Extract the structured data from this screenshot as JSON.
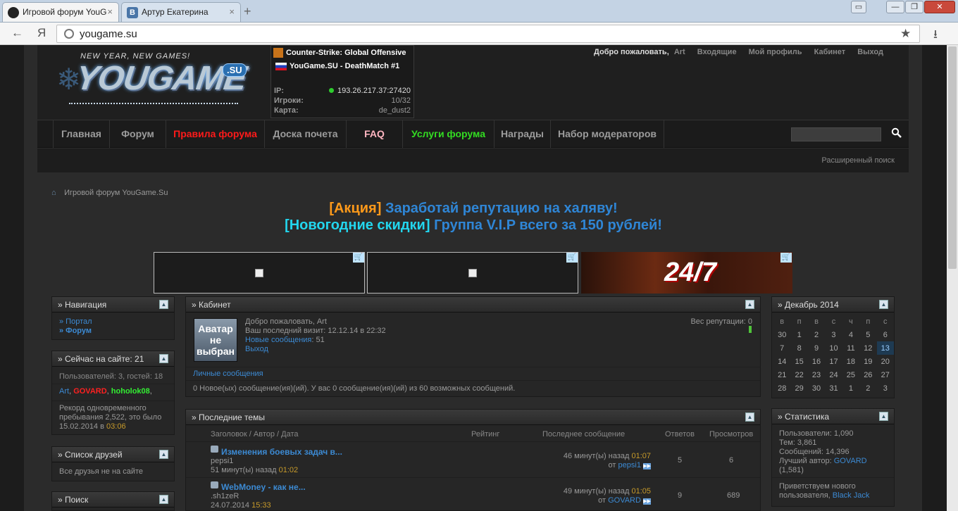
{
  "browser": {
    "tabs": [
      {
        "label": "Игровой форум YouG",
        "close": "×"
      },
      {
        "label": "Артур Екатерина",
        "close": "×"
      }
    ],
    "new_tab": "+",
    "window_controls": [
      "▭",
      "—",
      "❐",
      "✕"
    ],
    "url": "yougame.su",
    "yandex_label": "Я",
    "back": "←",
    "star": "★",
    "download": "⭳"
  },
  "logo": {
    "tagline": "NEW YEAR, NEW GAMES!",
    "text": "YOUGAME",
    "badge": ".SU"
  },
  "server": {
    "game": "Counter-Strike: Global Offensive",
    "name": "YouGame.SU - DeathMatch #1",
    "ip_label": "IP:",
    "ip": "193.26.217.37:27420",
    "players_label": "Игроки:",
    "players": "10/32",
    "map_label": "Карта:",
    "map": "de_dust2"
  },
  "user_links": {
    "welcome": "Добро пожаловать,",
    "user": "Art",
    "inbox": "Входящие",
    "profile": "Мой профиль",
    "cabinet": "Кабинет",
    "logout": "Выход"
  },
  "nav": [
    {
      "label": "Главная",
      "color": "#9c9c9c"
    },
    {
      "label": "Форум",
      "color": "#9c9c9c"
    },
    {
      "label": "Правила форума",
      "color": "#ff1a1a"
    },
    {
      "label": "Доска почета",
      "color": "#9c9c9c"
    },
    {
      "label": "FAQ",
      "color": "#ffb6c1"
    },
    {
      "label": "Услуги форума",
      "color": "#33dd22"
    },
    {
      "label": "Награды",
      "color": "#9c9c9c"
    },
    {
      "label": "Набор модераторов",
      "color": "#9c9c9c"
    }
  ],
  "advanced_search": "Расширенный поиск",
  "breadcrumb": "Игровой форум YouGame.Su",
  "promo": {
    "line1_tag": "[Акция]",
    "line1_text": "Заработай репутацию на халяву!",
    "line2_tag": "[Новогодние скидки]",
    "line2_text": "Группа V.I.P всего за 150 рублей!"
  },
  "banner_text": "24/7",
  "left": {
    "navigation": {
      "title": "» Навигация",
      "items": [
        "» Портал",
        "» Форум"
      ]
    },
    "online": {
      "title": "» Сейчас на сайте: 21",
      "stats": "Пользователей: 3, гостей: 18",
      "users": [
        {
          "name": "Art",
          "color": "#3c8ad3"
        },
        {
          "name": "GOVARD",
          "color": "#ff2020"
        },
        {
          "name": "hoholok08",
          "color": "#33ee33"
        }
      ],
      "record_text": "Рекорд одновременного пребывания 2,522, это было 15.02.2014 в",
      "record_time": "03:06"
    },
    "friends": {
      "title": "» Список друзей",
      "text": "Все друзья не на сайте"
    },
    "search": {
      "title": "» Поиск"
    }
  },
  "cabinet": {
    "title": "» Кабинет",
    "avatar": "Аватар не выбран",
    "welcome": "Добро пожаловать, Art",
    "last_visit": "Ваш последний визит: 12.12.14 в 22:32",
    "new_messages_label": "Новые сообщения",
    "new_messages_count": ": 51",
    "logout": "Выход",
    "reputation": "Вес репутации: 0",
    "pm_link": "Личные сообщения",
    "pm_text": "0 Новое(ых) сообщение(ия)(ий). У вас 0 сообщение(ия)(ий) из 60 возможных сообщений."
  },
  "latest": {
    "title": "» Последние темы",
    "columns": [
      "Заголовок / Автор / Дата",
      "Рейтинг",
      "Последнее сообщение",
      "Ответов",
      "Просмотров"
    ],
    "rows": [
      {
        "title": "Изменения боевых задач в...",
        "author": "pepsi1",
        "date": "51 минут(ы) назад",
        "date_time": "01:02",
        "last": "46 минут(ы) назад",
        "last_time": "01:07",
        "last_prefix": "от",
        "last_user": "pepsi1",
        "replies": "5",
        "views": "6"
      },
      {
        "title": "WebMoney - как не...",
        "author": ".sh1zeR",
        "date": "24.07.2014",
        "date_time": "15:33",
        "last": "49 минут(ы) назад",
        "last_time": "01:05",
        "last_prefix": "от",
        "last_user": "GOVARD",
        "replies": "9",
        "views": "689"
      }
    ]
  },
  "calendar": {
    "title": "» Декабрь 2014",
    "weekdays": [
      "в",
      "п",
      "в",
      "с",
      "ч",
      "п",
      "с"
    ],
    "weeks": [
      [
        "30",
        "1",
        "2",
        "3",
        "4",
        "5",
        "6"
      ],
      [
        "7",
        "8",
        "9",
        "10",
        "11",
        "12",
        "13"
      ],
      [
        "14",
        "15",
        "16",
        "17",
        "18",
        "19",
        "20"
      ],
      [
        "21",
        "22",
        "23",
        "24",
        "25",
        "26",
        "27"
      ],
      [
        "28",
        "29",
        "30",
        "31",
        "1",
        "2",
        "3"
      ]
    ],
    "today": "13"
  },
  "stats": {
    "title": "» Статистика",
    "users": "Пользователи: 1,090",
    "topics": "Тем: 3,861",
    "posts": "Сообщений: 14,396",
    "best_label": "Лучший автор:",
    "best_user": "GOVARD",
    "best_count": "(1,581)",
    "welcome_text": "Приветствуем нового пользователя,",
    "new_user": "Black Jack"
  }
}
